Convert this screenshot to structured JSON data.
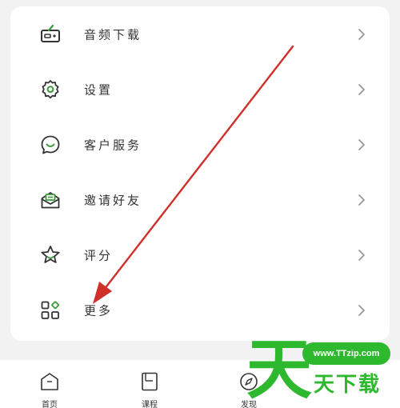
{
  "menu": {
    "items": [
      {
        "label": "音频下载",
        "icon": "radio-icon"
      },
      {
        "label": "设置",
        "icon": "gear-icon"
      },
      {
        "label": "客户服务",
        "icon": "chat-smile-icon"
      },
      {
        "label": "邀请好友",
        "icon": "envelope-icon"
      },
      {
        "label": "评分",
        "icon": "star-icon"
      },
      {
        "label": "更多",
        "icon": "grid-icon"
      }
    ]
  },
  "tabbar": {
    "tabs": [
      {
        "label": "首页",
        "icon": "home-icon"
      },
      {
        "label": "课程",
        "icon": "book-icon"
      },
      {
        "label": "发现",
        "icon": "compass-icon"
      }
    ]
  },
  "watermark": {
    "url": "www.TTzip.com",
    "big_char": "天",
    "text": "天下载"
  },
  "colors": {
    "accent": "#3a9a3a",
    "annotation_arrow": "#d0302a",
    "watermark_green": "#2eb82e"
  }
}
